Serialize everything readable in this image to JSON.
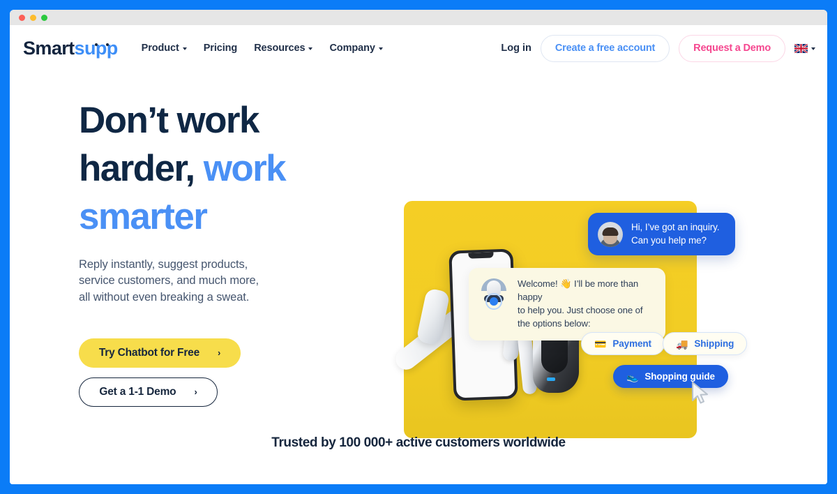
{
  "window": {
    "traffic_lights": [
      "close",
      "minimize",
      "maximize"
    ],
    "frame_color": "#0b7cf7"
  },
  "header": {
    "logo": {
      "part1": "Smart",
      "part2": "supp"
    },
    "nav": [
      {
        "label": "Product",
        "has_dropdown": true
      },
      {
        "label": "Pricing",
        "has_dropdown": false
      },
      {
        "label": "Resources",
        "has_dropdown": true
      },
      {
        "label": "Company",
        "has_dropdown": true
      }
    ],
    "login_label": "Log in",
    "create_account_label": "Create a free account",
    "request_demo_label": "Request a Demo",
    "language": {
      "code": "EN",
      "flag": "uk-flag-icon"
    },
    "colors": {
      "blue": "#4a90f5",
      "pink": "#f5478f",
      "navy": "#22314a"
    }
  },
  "hero": {
    "heading_line1": "Don’t work",
    "heading_line2_dark": "harder,",
    "heading_line2_accent": "work",
    "heading_line3_accent": "smarter",
    "subtitle_line1": "Reply instantly, suggest products,",
    "subtitle_line2": "service customers, and much more,",
    "subtitle_line3": "all without even breaking a sweat.",
    "primary_cta": "Try Chatbot for Free",
    "primary_cta_chevron": "›",
    "secondary_cta": "Get a 1-1 Demo",
    "secondary_cta_chevron": "›",
    "colors": {
      "accent": "#4a90f5",
      "heading": "#0f2744",
      "cta_yellow": "#f7dd4b"
    }
  },
  "illustration": {
    "panel_color": "#f2cd24",
    "user_message_line1": "Hi, I’ve got an inquiry.",
    "user_message_line2": "Can you help me?",
    "bot_message_line1": "Welcome! 👋 I’ll be more than happy",
    "bot_message_line2": "to help you. Just choose one of",
    "bot_message_line3": "the options below:",
    "options": [
      {
        "label": "Payment",
        "emoji": "💳",
        "style": "light"
      },
      {
        "label": "Shipping",
        "emoji": "🚚",
        "style": "light"
      },
      {
        "label": "Shopping guide",
        "emoji": "👟",
        "style": "solid"
      }
    ],
    "cursor": "mouse-pointer-icon"
  },
  "footer": {
    "trusted_text": "Trusted by 100 000+ active customers worldwide"
  }
}
